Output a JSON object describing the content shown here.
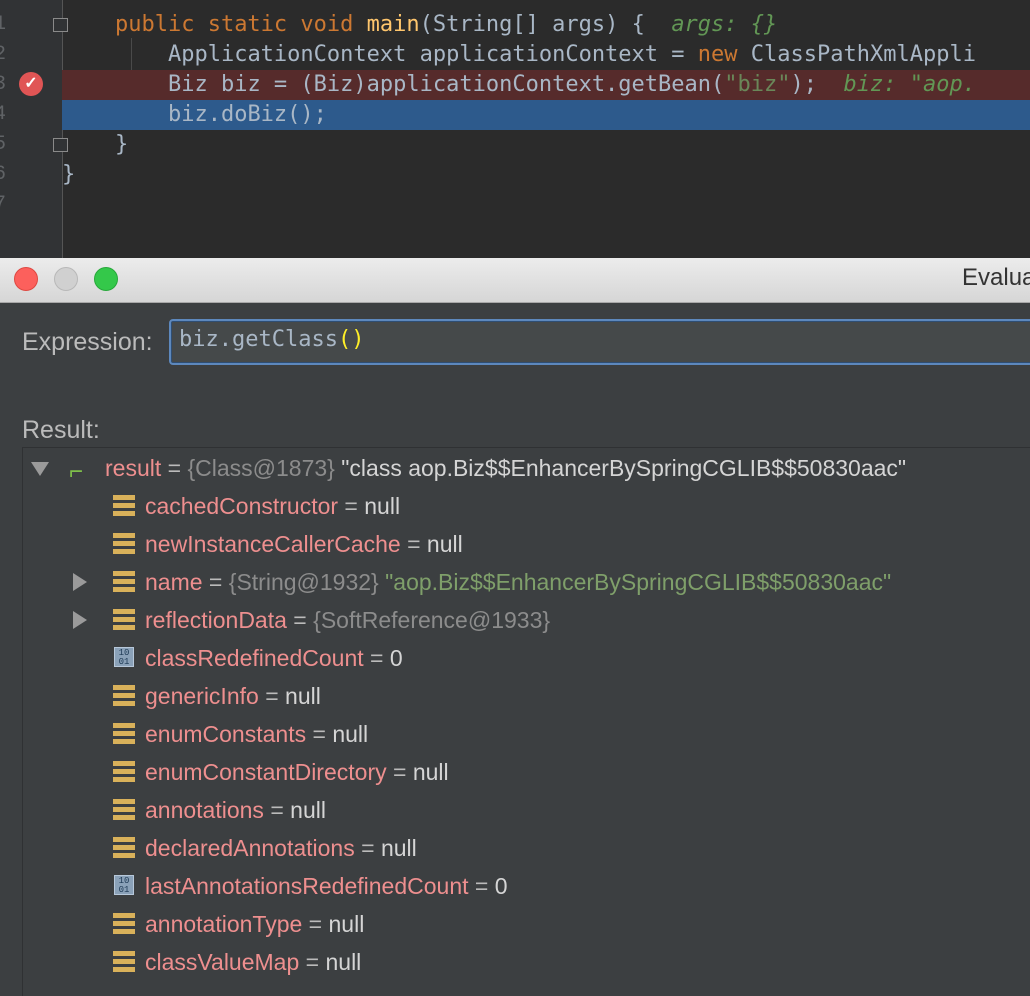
{
  "editor": {
    "line_numbers": [
      "1",
      "2",
      "3",
      "4",
      "5",
      "6",
      "7"
    ],
    "lines": [
      {
        "kw1": "public static void ",
        "fn": "main",
        "rest": "(String[] args) {  ",
        "inline": "args: {}"
      },
      {
        "text1": "ApplicationContext applicationContext = ",
        "kw": "new",
        "text2": " ClassPathXmlAppli"
      },
      {
        "text1": "Biz biz = (Biz)applicationContext.getBean(",
        "str": "\"biz\"",
        "text2": ");  ",
        "inline": "biz: \"aop."
      },
      {
        "text1": "biz.doBiz();"
      },
      {
        "text1": "}"
      },
      {
        "text1": "}"
      }
    ]
  },
  "dialog": {
    "window_title": "Evalua",
    "expression_label": "Expression:",
    "expression_value": "biz.getClass",
    "expression_parens": "()",
    "result_label": "Result:"
  },
  "result_tree": {
    "root": {
      "name": "result",
      "eq": " = ",
      "ref": "{Class@1873}",
      "value": " \"class aop.Biz$$EnhancerBySpringCGLIB$$50830aac\""
    },
    "children": [
      {
        "icon": "field-icon",
        "name": "cachedConstructor",
        "value": "null"
      },
      {
        "icon": "field-icon",
        "name": "newInstanceCallerCache",
        "value": "null"
      },
      {
        "icon": "field-icon",
        "name": "name",
        "ref": "{String@1932}",
        "svalue": "\"aop.Biz$$EnhancerBySpringCGLIB$$50830aac\"",
        "expandable": true
      },
      {
        "icon": "field-icon",
        "name": "reflectionData",
        "ref": "{SoftReference@1933}",
        "expandable": true
      },
      {
        "icon": "primitive-icon",
        "name": "classRedefinedCount",
        "value": "0"
      },
      {
        "icon": "field-icon",
        "name": "genericInfo",
        "value": "null"
      },
      {
        "icon": "field-icon",
        "name": "enumConstants",
        "value": "null"
      },
      {
        "icon": "field-icon",
        "name": "enumConstantDirectory",
        "value": "null"
      },
      {
        "icon": "field-icon",
        "name": "annotations",
        "value": "null"
      },
      {
        "icon": "field-icon",
        "name": "declaredAnnotations",
        "value": "null"
      },
      {
        "icon": "primitive-icon",
        "name": "lastAnnotationsRedefinedCount",
        "value": "0"
      },
      {
        "icon": "field-icon",
        "name": "annotationType",
        "value": "null"
      },
      {
        "icon": "field-icon",
        "name": "classValueMap",
        "value": "null"
      }
    ],
    "eq": " = ",
    "binary_glyph": "10\n01"
  },
  "colors": {
    "breakpoint_line": "#562b2b",
    "execution_line": "#2d5a8c",
    "field_name": "#ee8f8f",
    "string_value": "#7f9f6a"
  }
}
